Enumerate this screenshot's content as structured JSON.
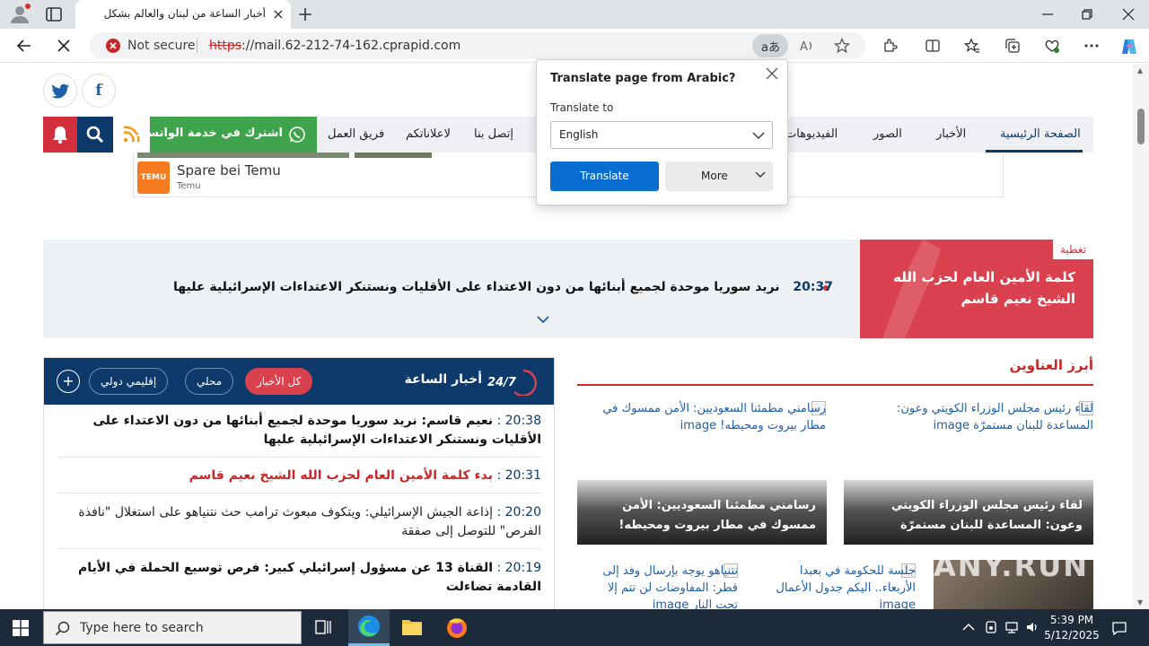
{
  "browser": {
    "tab_title": "أخبار الساعة من لبنان والعالم بشكل",
    "security_label": "Not secure",
    "url_scheme": "https",
    "url_rest": "://mail.62-212-74-162.cprapid.com",
    "translate_pill": "aあ"
  },
  "translate_popup": {
    "title": "Translate page from Arabic?",
    "translate_to_label": "Translate to",
    "language": "English",
    "translate_button": "Translate",
    "more_button": "More"
  },
  "social": {
    "twitter_icon": "twitter-icon",
    "facebook_letter": "f"
  },
  "nav": {
    "whatsapp": "اشترك في خدمة الواتساب",
    "items": [
      "فريق العمل",
      "لاعلاناتكم",
      "إتصل بنا",
      "الفيديوهات",
      "الصور",
      "الأخبار",
      "الصفحة الرئيسية"
    ]
  },
  "ad": {
    "logo": "TEMU",
    "title": "Spare bei Temu",
    "sub": "Temu"
  },
  "ticker": {
    "time": "20:37",
    "text": "نريد سوريا موحدة لجميع أبنائها من دون الاعتداء على الأقليات ونستنكر الاعتداءات الإسرائيلية عليها"
  },
  "coverage": {
    "tag": "تغطية",
    "title": "كلمة الأمين العام لحزب الله الشيخ نعيم قاسم"
  },
  "live": {
    "title": "أخبار الساعة",
    "logo_text": "24/7",
    "filters": [
      "كل الأخبار",
      "محلي",
      "إقليمي دولي"
    ],
    "plus": "+",
    "items": [
      {
        "time": "20:38",
        "text": "نعيم قاسم: نريد سوريا موحدة لجميع أبنائها من دون الاعتداء على الأقليات ونستنكر الاعتداءات الإسرائيلية عليها",
        "style": "bold"
      },
      {
        "time": "20:31",
        "text": "بدء كلمة الأمين العام لحزب الله الشيخ نعيم قاسم",
        "style": "red"
      },
      {
        "time": "20:20",
        "text": "إذاعة الجيش الإسرائيلي: ويتكوف مبعوث ترامب حث نتنياهو على استغلال \"نافذة الفرص\" للتوصل إلى صفقة",
        "style": "plain"
      },
      {
        "time": "20:19",
        "text": "القناة 13 عن مسؤول إسرائيلي كبير: فرص توسيع الحملة في الأيام القادمة تضاءلت",
        "style": "bold"
      }
    ]
  },
  "headlines": {
    "title": "أبرز العناوين",
    "cards": [
      {
        "alt": "لقاء رئيس مجلس الوزراء الكويتي وعون: المساعدة للبنان مستمرّة image",
        "title": "لقاء رئيس مجلس الوزراء الكويتي وعون: المساعدة للبنان مستمرّة"
      },
      {
        "alt": "رسامني مطمئنا السعوديين: الأمن ممسوك في مطار بيروت ومحيطه! image",
        "title": "رسامني مطمئنا السعوديين: الأمن ممسوك في مطار بيروت ومحيطه!"
      }
    ],
    "small": [
      {
        "alt": "جلسة للحكومة في بعبدا الأربعاء.. اليكم جدول الأعمال image"
      },
      {
        "alt": "نتنياهو يوجه بإرسال وفد إلى قطر: المفاوضات لن تتم إلا تحت النار image"
      }
    ]
  },
  "watermark": "ANY.RUN",
  "taskbar": {
    "search_placeholder": "Type here to search",
    "time": "5:39 PM",
    "date": "5/12/2025"
  }
}
